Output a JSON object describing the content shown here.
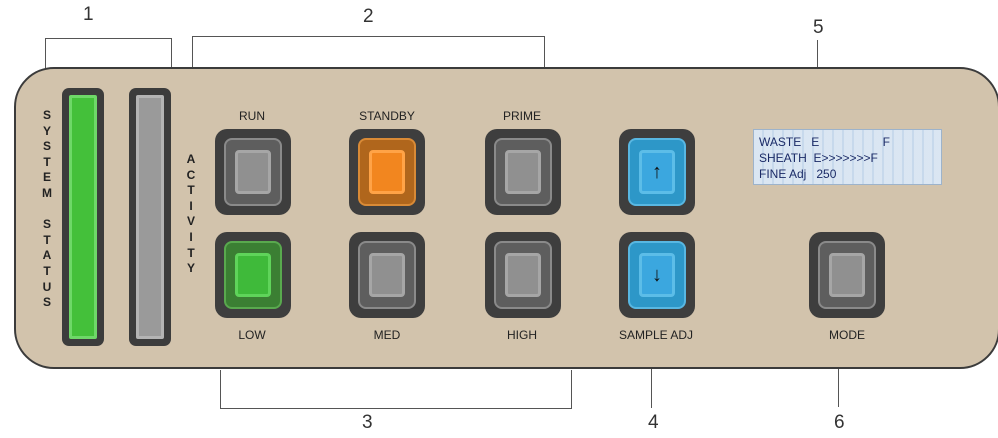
{
  "callouts": {
    "c1": "1",
    "c2": "2",
    "c3": "3",
    "c4": "4",
    "c5": "5",
    "c6": "6"
  },
  "indicators": {
    "system_status": "S\nY\nS\nT\nE\nM\n\nS\nT\nA\nT\nU\nS",
    "activity": "A\nC\nT\nI\nV\nI\nT\nY"
  },
  "buttons": {
    "run": "RUN",
    "standby": "STANDBY",
    "prime": "PRIME",
    "low": "LOW",
    "med": "MED",
    "high": "HIGH",
    "sample_adj": "SAMPLE ADJ",
    "mode": "MODE",
    "up_arrow": "↑",
    "down_arrow": "↓"
  },
  "display": {
    "row1": "WASTE   E                   F",
    "row2": "SHEATH  E>>>>>>>F",
    "row3": "FINE Adj   250"
  },
  "colors": {
    "panel": "#d2c3ac",
    "status_green": "#44c03a",
    "standby_orange": "#f2861f",
    "sample_adj_blue": "#3ba7df",
    "lcd_background": "#c7d9ec"
  }
}
